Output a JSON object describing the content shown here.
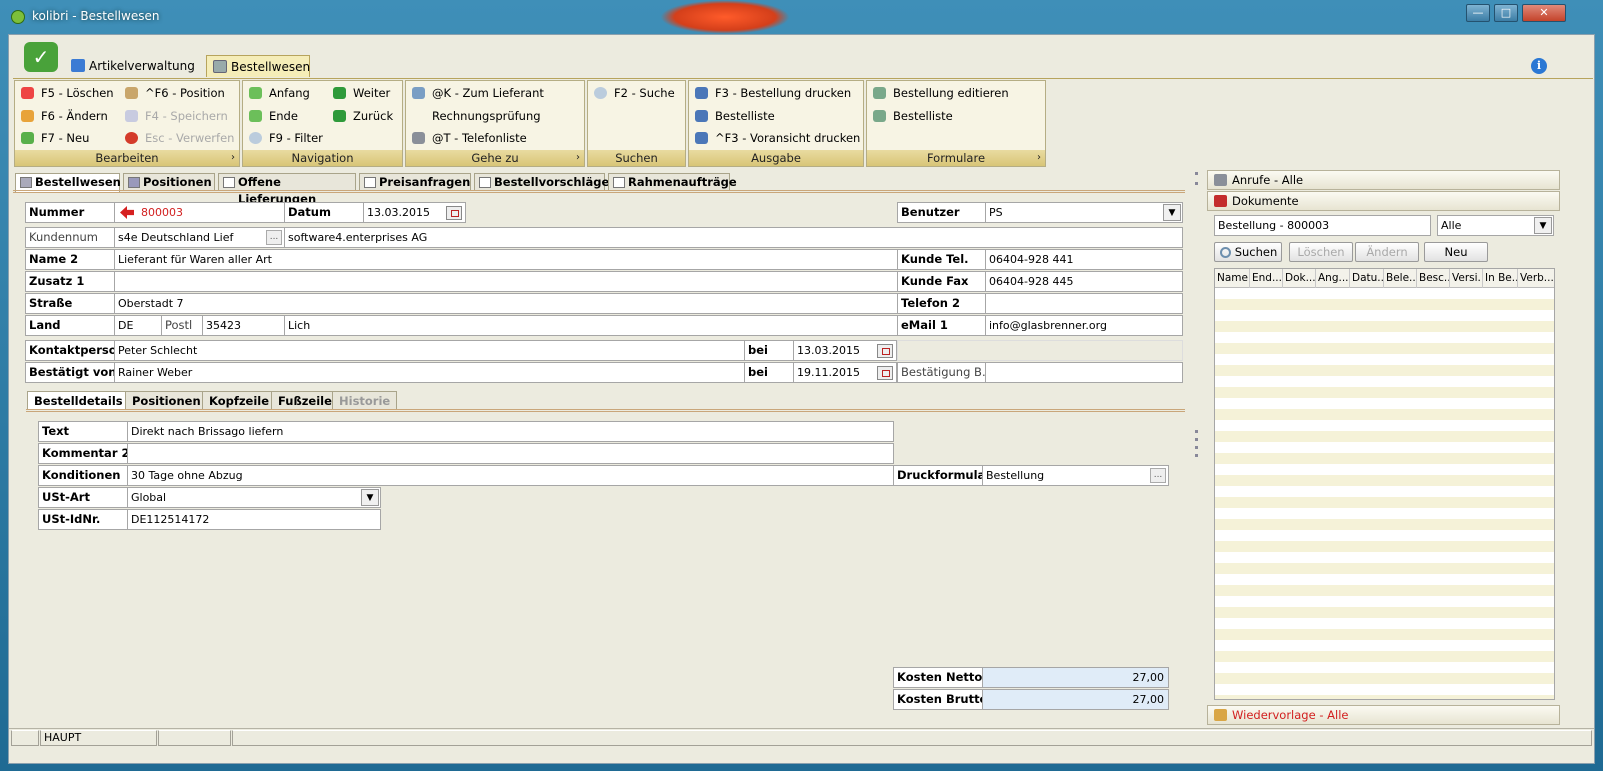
{
  "window": {
    "title": "kolibri - Bestellwesen",
    "min": "—",
    "max": "□",
    "close": "✕"
  },
  "app_tabs": [
    {
      "label": "Artikelverwaltung"
    },
    {
      "label": "Bestellwesen"
    }
  ],
  "ribbon": {
    "groups": [
      {
        "label": "Bearbeiten",
        "has_launcher": true
      },
      {
        "label": "Navigation"
      },
      {
        "label": "Gehe zu",
        "has_launcher": true
      },
      {
        "label": "Suchen"
      },
      {
        "label": "Ausgabe"
      },
      {
        "label": "Formulare",
        "has_launcher": true
      }
    ],
    "bearbeiten": [
      "F5 - Löschen",
      "F6 - Ändern",
      "F7 - Neu",
      "^F6 - Position",
      "F4 - Speichern",
      "Esc - Verwerfen"
    ],
    "navigation": [
      "Anfang",
      "Ende",
      "F9 - Filter",
      "Weiter",
      "Zurück"
    ],
    "gehe_zu": [
      "@K - Zum Lieferant",
      "Rechnungsprüfung",
      "@T - Telefonliste"
    ],
    "suchen": [
      "F2 - Suche"
    ],
    "ausgabe": [
      "F3 - Bestellung drucken",
      "Bestelliste",
      "^F3 - Voransicht drucken"
    ],
    "formulare": [
      "Bestellung editieren",
      "Bestelliste"
    ],
    "launcher_glyph": "›"
  },
  "main_tabs": [
    "Bestellwesen",
    "Positionen",
    "Offene Lieferungen",
    "Preisanfragen",
    "Bestellvorschläge",
    "Rahmenaufträge"
  ],
  "form": {
    "nummer_label": "Nummer",
    "nummer_value": "800003",
    "datum_label": "Datum",
    "datum_value": "13.03.2015",
    "benutzer_label": "Benutzer",
    "benutzer_value": "PS",
    "kundennum_label": "Kundennum",
    "kundennum_value": "s4e Deutschland Lief",
    "kundennum_name": "software4.enterprises AG",
    "name2_label": "Name 2",
    "name2_value": "Lieferant für Waren aller Art",
    "zusatz1_label": "Zusatz 1",
    "zusatz1_value": "",
    "strasse_label": "Straße",
    "strasse_value": "Oberstadt 7",
    "land_label": "Land",
    "land_value": "DE",
    "postl_label": "Postl",
    "plz_value": "35423",
    "ort_value": "Lich",
    "kunde_tel_label": "Kunde Tel.",
    "kunde_tel_value": "06404-928 441",
    "kunde_fax_label": "Kunde Fax",
    "kunde_fax_value": "06404-928 445",
    "telefon2_label": "Telefon 2",
    "telefon2_value": "",
    "email1_label": "eMail 1",
    "email1_value": "info@glasbrenner.org",
    "kontakt_label": "Kontaktperson",
    "kontakt_value": "Peter Schlecht",
    "bei_label": "bei",
    "kontakt_bei": "13.03.2015",
    "bestaetigt_label": "Bestätigt von",
    "bestaetigt_value": "Rainer Weber",
    "bestaetigt_bei": "19.11.2015",
    "bestaetigung_label": "Bestätigung B...",
    "bestaetigung_value": ""
  },
  "sub_tabs": [
    "Bestelldetails",
    "Positionen",
    "Kopfzeile",
    "Fußzeile",
    "Historie"
  ],
  "details": {
    "text_label": "Text",
    "text_value": "Direkt nach Brissago liefern",
    "kommentar2_label": "Kommentar 2",
    "kommentar2_value": "",
    "konditionen_label": "Konditionen",
    "konditionen_value": "30 Tage ohne Abzug",
    "druckformular_label": "Druckformular",
    "druckformular_value": "Bestellung",
    "ust_art_label": "USt-Art",
    "ust_art_value": "Global",
    "ust_idnr_label": "USt-IdNr.",
    "ust_idnr_value": "DE112514172",
    "kosten_netto_label": "Kosten Netto",
    "kosten_netto_value": "27,00",
    "kosten_brutto_label": "Kosten Brutto",
    "kosten_brutto_value": "27,00"
  },
  "right_panel": {
    "anrufe": "Anrufe - Alle",
    "dokumente": "Dokumente",
    "doc_search_value": "Bestellung - 800003",
    "doc_filter_value": "Alle",
    "buttons": {
      "suchen": "Suchen",
      "loeschen": "Löschen",
      "aendern": "Ändern",
      "neu": "Neu"
    },
    "grid_columns": [
      "Name",
      "End...",
      "Dok...",
      "Ang...",
      "Datu...",
      "Bele...",
      "Besc...",
      "Versi...",
      "In Be...",
      "Verb..."
    ],
    "wiedervorlage": "Wiedervorlage - Alle"
  },
  "status": {
    "cell2": "HAUPT"
  },
  "colors": {
    "accent_tab": "#f5edb8",
    "ribbon_group_label": "#d8c577",
    "number_red": "#d21f1f",
    "amount_bg": "#e0ecf8"
  }
}
